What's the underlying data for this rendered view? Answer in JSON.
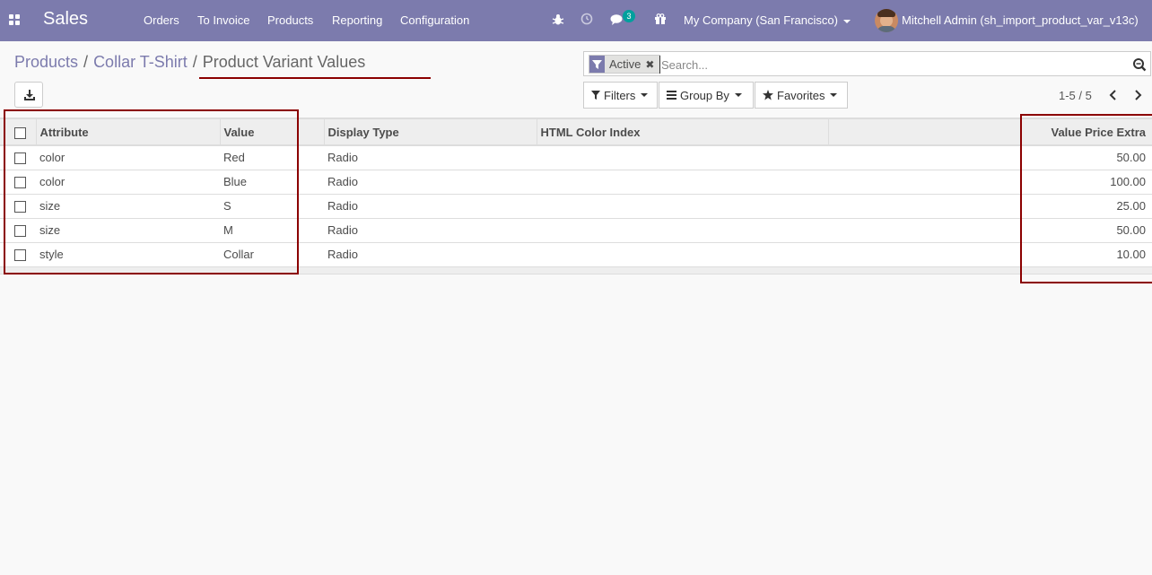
{
  "navbar": {
    "brand": "Sales",
    "menu": [
      "Orders",
      "To Invoice",
      "Products",
      "Reporting",
      "Configuration"
    ],
    "icons": [
      "apps-icon",
      "bug-icon",
      "clock-icon",
      "chat-icon",
      "gift-icon"
    ],
    "chat_count": "3",
    "company": "My Company (San Francisco)",
    "user": "Mitchell Admin (sh_import_product_var_v13c)",
    "color": "#7c7bad"
  },
  "breadcrumb": {
    "items": [
      "Products",
      "Collar T-Shirt"
    ],
    "current": "Product Variant Values"
  },
  "search": {
    "facet": "Active",
    "placeholder": "Search..."
  },
  "filters": {
    "filters_label": "Filters",
    "groupby_label": "Group By",
    "favorites_label": "Favorites"
  },
  "pager": {
    "range": "1-5 / 5"
  },
  "table": {
    "columns": [
      "Attribute",
      "Value",
      "Display Type",
      "HTML Color Index",
      "",
      "Value Price Extra"
    ],
    "rows": [
      [
        "color",
        "Red",
        "Radio",
        "",
        "",
        "50.00"
      ],
      [
        "color",
        "Blue",
        "Radio",
        "",
        "",
        "100.00"
      ],
      [
        "size",
        "S",
        "Radio",
        "",
        "",
        "25.00"
      ],
      [
        "size",
        "M",
        "Radio",
        "",
        "",
        "50.00"
      ],
      [
        "style",
        "Collar",
        "Radio",
        "",
        "",
        "10.00"
      ]
    ]
  },
  "colors": {
    "highlight": "#8b0000",
    "accent": "#7c7bad"
  }
}
